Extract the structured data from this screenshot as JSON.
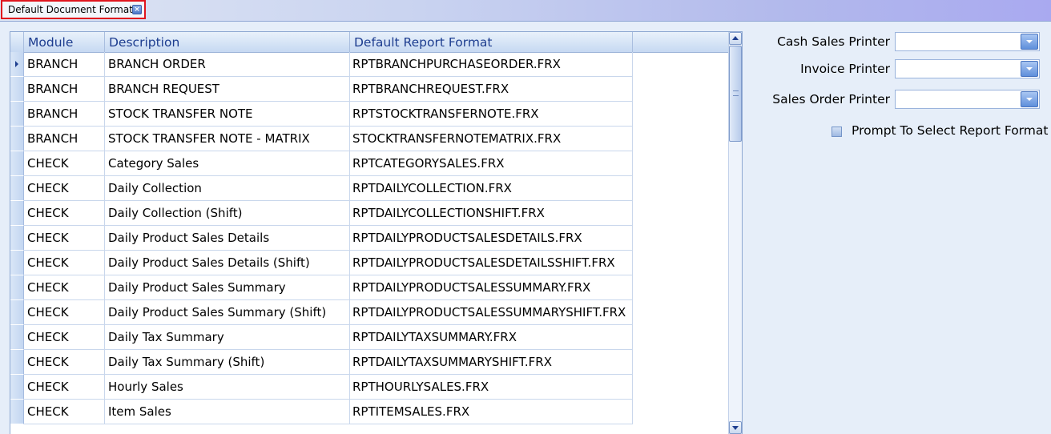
{
  "tab": {
    "title": "Default Document Format"
  },
  "grid": {
    "headers": [
      "Module",
      "Description",
      "Default Report Format"
    ],
    "rows": [
      [
        "BRANCH",
        "BRANCH ORDER",
        "RPTBRANCHPURCHASEORDER.FRX"
      ],
      [
        "BRANCH",
        "BRANCH REQUEST",
        "RPTBRANCHREQUEST.FRX"
      ],
      [
        "BRANCH",
        "STOCK TRANSFER NOTE",
        "RPTSTOCKTRANSFERNOTE.FRX"
      ],
      [
        "BRANCH",
        "STOCK TRANSFER NOTE - MATRIX",
        "STOCKTRANSFERNOTEMATRIX.FRX"
      ],
      [
        "CHECK",
        "Category Sales",
        "RPTCATEGORYSALES.FRX"
      ],
      [
        "CHECK",
        "Daily Collection",
        "RPTDAILYCOLLECTION.FRX"
      ],
      [
        "CHECK",
        "Daily Collection (Shift)",
        "RPTDAILYCOLLECTIONSHIFT.FRX"
      ],
      [
        "CHECK",
        "Daily Product Sales Details",
        "RPTDAILYPRODUCTSALESDETAILS.FRX"
      ],
      [
        "CHECK",
        "Daily Product Sales Details (Shift)",
        "RPTDAILYPRODUCTSALESDETAILSSHIFT.FRX"
      ],
      [
        "CHECK",
        "Daily Product Sales Summary",
        "RPTDAILYPRODUCTSALESSUMMARY.FRX"
      ],
      [
        "CHECK",
        "Daily Product Sales Summary (Shift)",
        "RPTDAILYPRODUCTSALESSUMMARYSHIFT.FRX"
      ],
      [
        "CHECK",
        "Daily Tax Summary",
        "RPTDAILYTAXSUMMARY.FRX"
      ],
      [
        "CHECK",
        "Daily Tax Summary (Shift)",
        "RPTDAILYTAXSUMMARYSHIFT.FRX"
      ],
      [
        "CHECK",
        "Hourly Sales",
        "RPTHOURLYSALES.FRX"
      ],
      [
        "CHECK",
        "Item Sales",
        "RPTITEMSALES.FRX"
      ]
    ]
  },
  "settings": {
    "cash_sales_printer_label": "Cash Sales Printer",
    "cash_sales_printer_value": "",
    "invoice_printer_label": "Invoice Printer",
    "invoice_printer_value": "",
    "sales_order_printer_label": "Sales Order Printer",
    "sales_order_printer_value": "",
    "prompt_label": "Prompt To Select Report Format",
    "prompt_checked": false
  }
}
